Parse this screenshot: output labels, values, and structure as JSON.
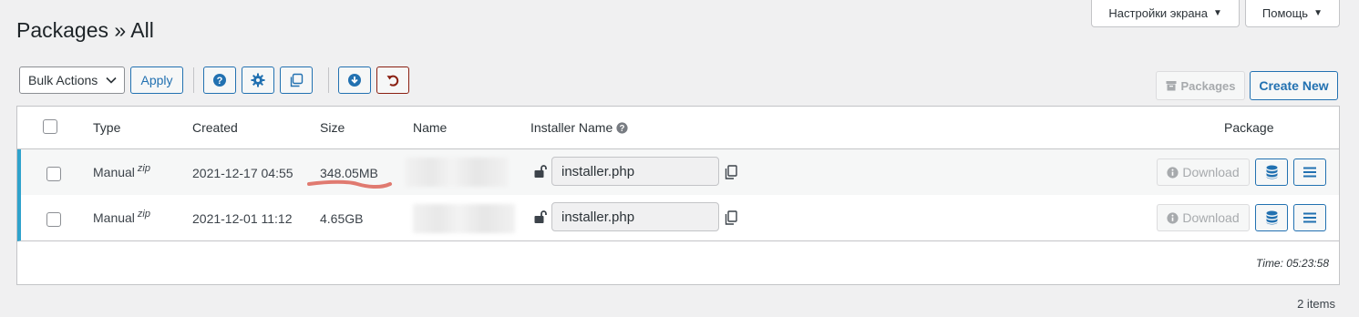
{
  "screen_options": {
    "label": "Настройки экрана"
  },
  "help": {
    "label": "Помощь"
  },
  "page": {
    "title": "Packages » All"
  },
  "toolbar": {
    "bulk_actions": "Bulk Actions",
    "apply": "Apply",
    "icons": [
      "question-circle-icon",
      "gear-icon",
      "clone-icon",
      "download-circle-icon",
      "undo-icon"
    ]
  },
  "actions": {
    "packages": "Packages",
    "create_new": "Create New"
  },
  "table": {
    "headers": {
      "type": "Type",
      "created": "Created",
      "size": "Size",
      "name": "Name",
      "installer_name": "Installer Name",
      "package": "Package"
    },
    "rows": [
      {
        "type": "Manual",
        "type_sup": "zip",
        "created": "2021-12-17 04:55",
        "size": "348.05MB",
        "installer": "installer.php",
        "download": "Download"
      },
      {
        "type": "Manual",
        "type_sup": "zip",
        "created": "2021-12-01 11:12",
        "size": "4.65GB",
        "installer": "installer.php",
        "download": "Download"
      }
    ],
    "time": "Time: 05:23:58"
  },
  "footer": {
    "items_count": "2 items"
  },
  "colors": {
    "accent": "#2271b1",
    "row_marker": "#2ea2cc",
    "undo": "#8a1f11",
    "annotation": "#e07a70"
  }
}
